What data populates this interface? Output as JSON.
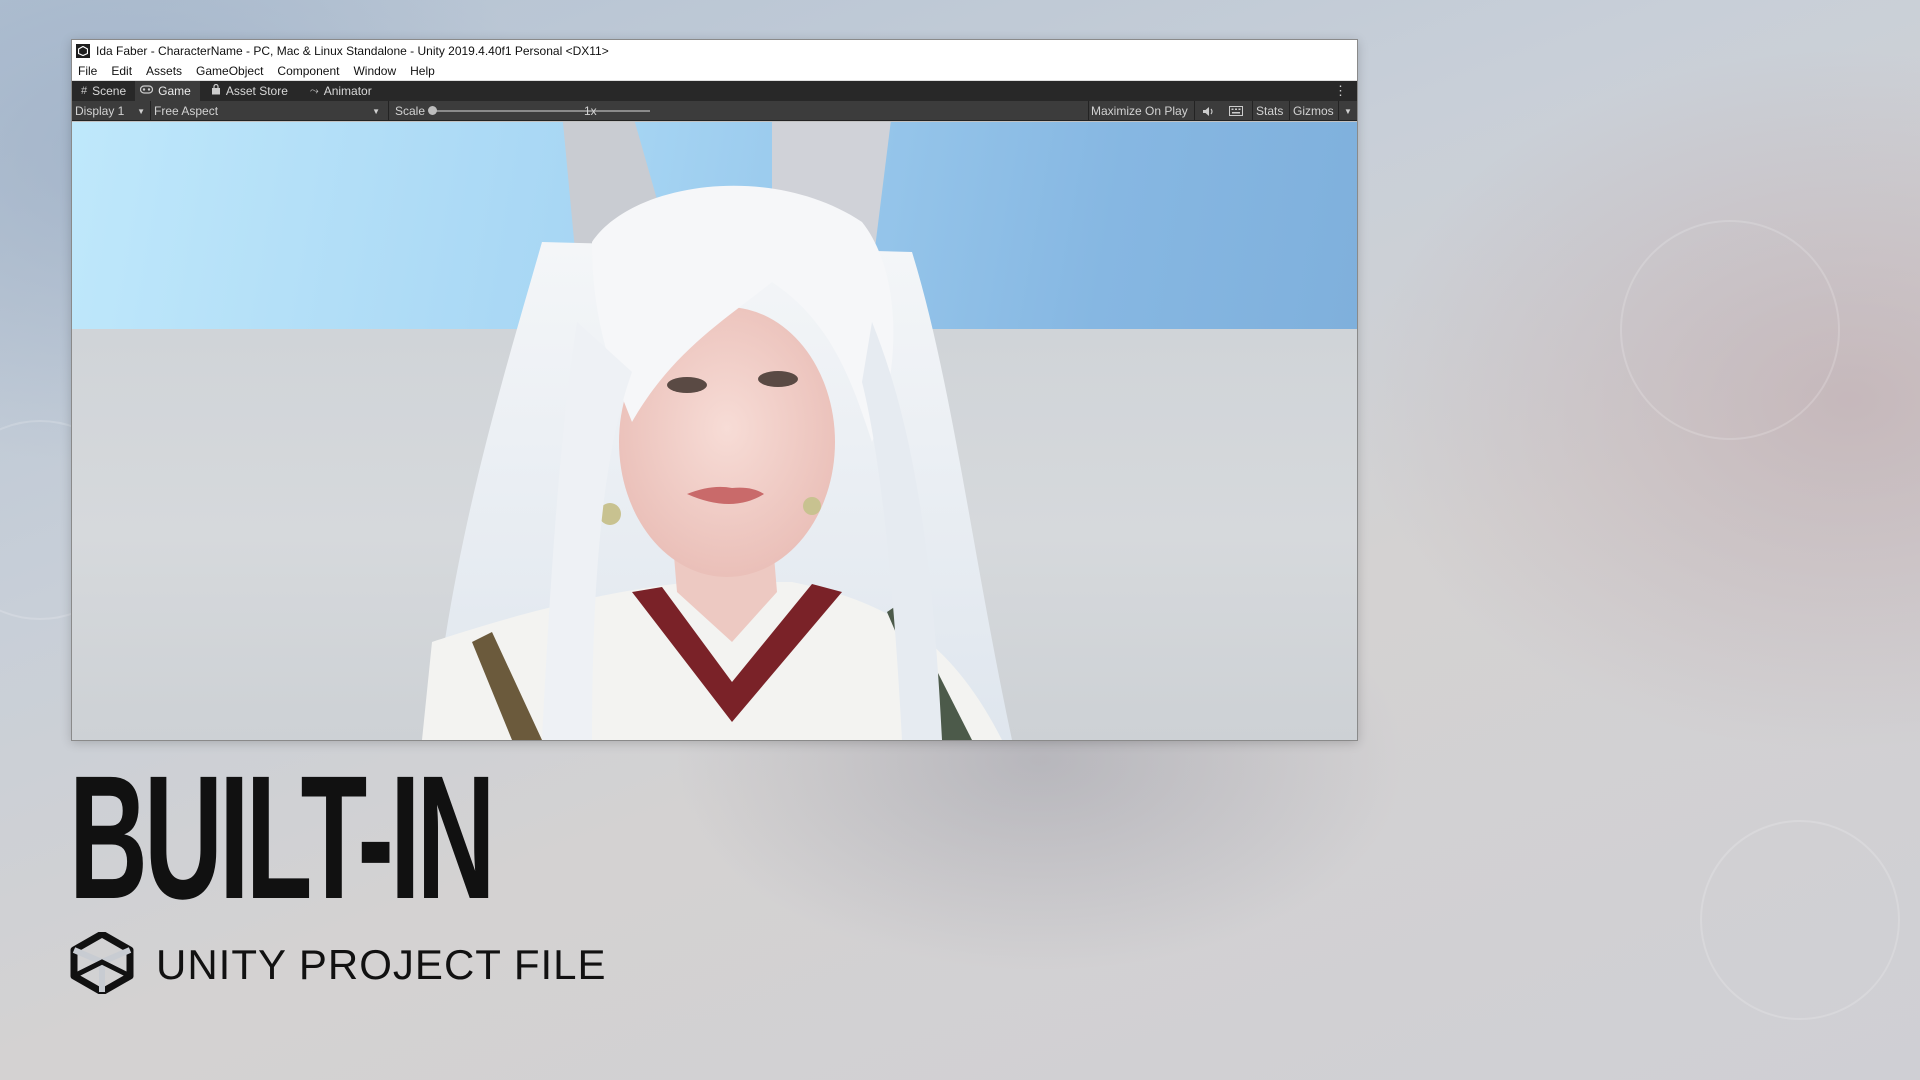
{
  "window": {
    "title": "Ida Faber - CharacterName - PC, Mac & Linux Standalone - Unity 2019.4.40f1 Personal <DX11>",
    "menu": [
      "File",
      "Edit",
      "Assets",
      "GameObject",
      "Component",
      "Window",
      "Help"
    ]
  },
  "tabs": [
    {
      "label": "Scene",
      "icon": "grid-icon"
    },
    {
      "label": "Game",
      "icon": "gamepad-icon"
    },
    {
      "label": "Asset Store",
      "icon": "lock-bag-icon"
    },
    {
      "label": "Animator",
      "icon": "animator-icon"
    }
  ],
  "toolbar": {
    "display": "Display 1",
    "aspect": "Free Aspect",
    "scale_label": "Scale",
    "scale_value": "1x",
    "scale_slider_fraction": 0.0,
    "maximize": "Maximize On Play",
    "stats": "Stats",
    "gizmos": "Gizmos"
  },
  "caption": {
    "headline": "BUILT-IN",
    "subline": "UNITY PROJECT FILE"
  },
  "colors": {
    "sky": "#a7d6f4",
    "ground": "#d0d4d8",
    "toolbar": "#3c3c3c",
    "tabbar": "#282828",
    "text_dark": "#111111"
  }
}
